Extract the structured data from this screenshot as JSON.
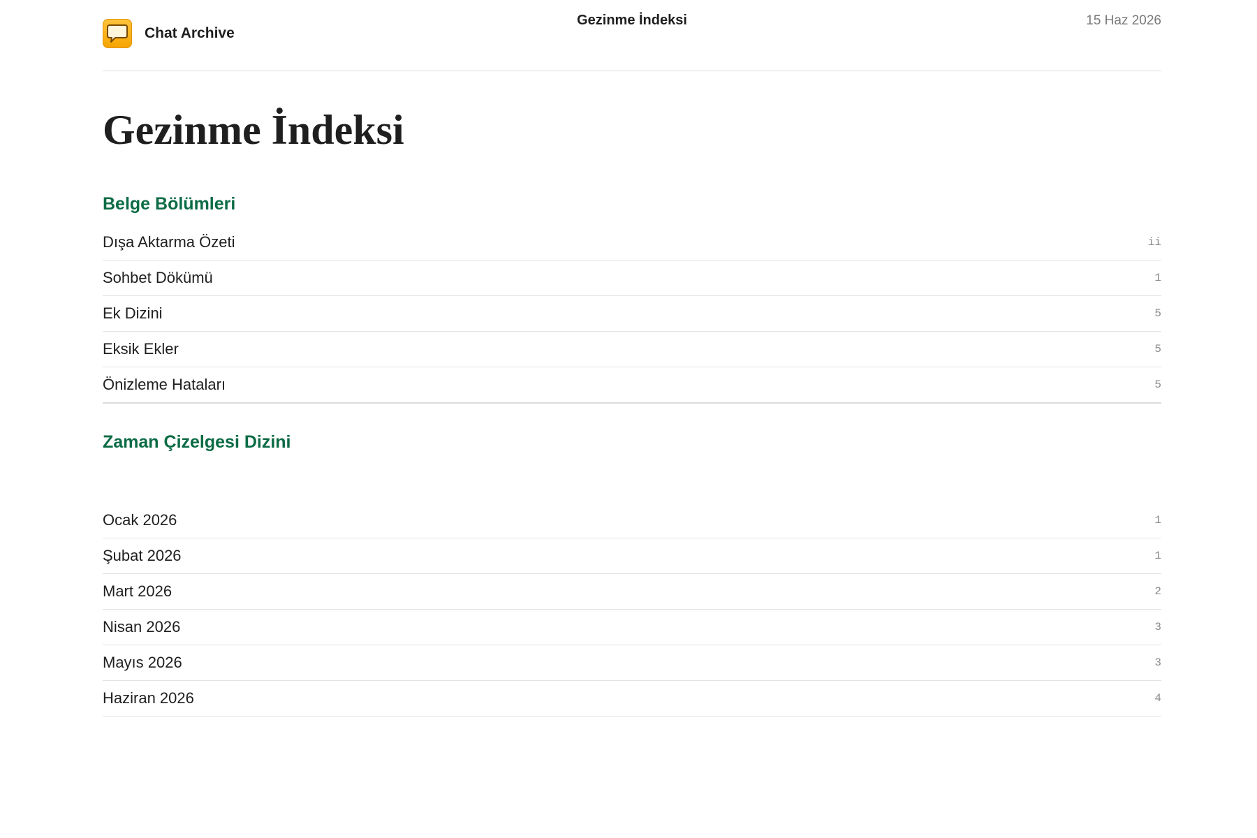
{
  "header": {
    "app_name": "Chat Archive",
    "app_icon": "chat-bubble-icon",
    "title": "Gezinme İndeksi",
    "date": "15 Haz 2026"
  },
  "page_title": "Gezinme İndeksi",
  "sections": [
    {
      "heading": "Belge Bölümleri",
      "items": [
        {
          "label": "Dışa Aktarma Özeti",
          "page": "ii"
        },
        {
          "label": "Sohbet Dökümü",
          "page": "1"
        },
        {
          "label": "Ek Dizini",
          "page": "5"
        },
        {
          "label": "Eksik Ekler",
          "page": "5"
        },
        {
          "label": "Önizleme Hataları",
          "page": "5"
        }
      ]
    },
    {
      "heading": "Zaman Çizelgesi Dizini",
      "items": [
        {
          "label": "Ocak 2026",
          "page": "1"
        },
        {
          "label": "Şubat 2026",
          "page": "1"
        },
        {
          "label": "Mart 2026",
          "page": "2"
        },
        {
          "label": "Nisan 2026",
          "page": "3"
        },
        {
          "label": "Mayıs 2026",
          "page": "3"
        },
        {
          "label": "Haziran 2026",
          "page": "4"
        }
      ]
    }
  ],
  "colors": {
    "accent": "#0b6b45",
    "icon_orange": "#f5a400"
  }
}
